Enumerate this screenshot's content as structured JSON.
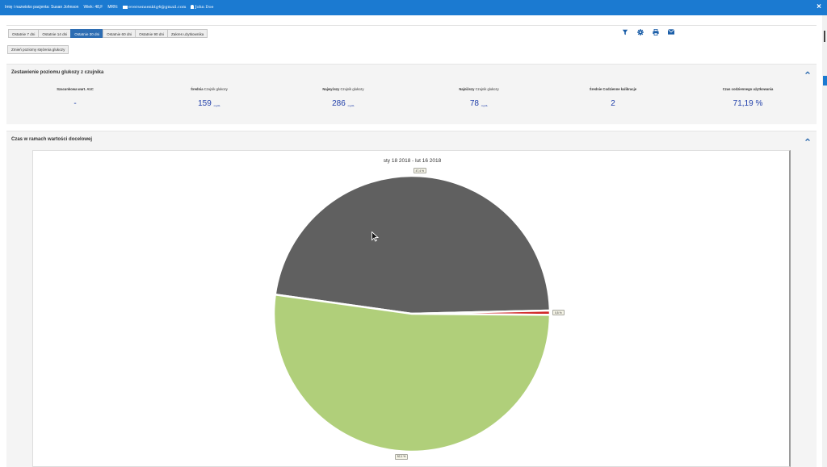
{
  "header": {
    "patient_label": "Imię i nazwisko pacjenta:",
    "patient_name": "Susan Johnson",
    "age_label": "Wiek:",
    "age_value": "48,F",
    "mrn_label": "MRN:",
    "email": "eversensenktg4@gmail.com",
    "user": "John Doe",
    "close_glyph": "×"
  },
  "tabs": [
    {
      "label": "Ostatnie 7 dni",
      "active": false
    },
    {
      "label": "Ostatnie 14 dni",
      "active": false
    },
    {
      "label": "Ostatnie 30 dni",
      "active": true
    },
    {
      "label": "Ostatnie 60 dni",
      "active": false
    },
    {
      "label": "Ostatnie 90 dni",
      "active": false
    },
    {
      "label": "Zakres użytkownika",
      "active": false
    }
  ],
  "toolbar": {
    "icons": [
      "filter-icon",
      "gear-icon",
      "print-icon",
      "envelope-icon"
    ]
  },
  "levels_button": "Zmień poziomy stężenia glukozy",
  "summary_panel": {
    "title": "Zestawienie poziomu glukozy z czujnika",
    "stats": [
      {
        "label_bold": "Szacunkowa wart. A1C",
        "label_rest": "",
        "value": "-",
        "unit": ""
      },
      {
        "label_bold": "Średnia",
        "label_rest": " Czujnik glukozy",
        "value": "159",
        "unit": "mg/dL"
      },
      {
        "label_bold": "Najwyższy",
        "label_rest": " Czujnik glukozy",
        "value": "286",
        "unit": "mg/dL"
      },
      {
        "label_bold": "Najniższy",
        "label_rest": " Czujnik glukozy",
        "value": "78",
        "unit": "mg/dL"
      },
      {
        "label_bold": "Średnie Codzienne kalibracje",
        "label_rest": "",
        "value": "2",
        "unit": ""
      },
      {
        "label_bold": "Czas codziennego użytkowania",
        "label_rest": "",
        "value": "71,19 %",
        "unit": ""
      }
    ]
  },
  "time_in_range_panel": {
    "title": "Czas w ramach wartości docelowej"
  },
  "chart_data": {
    "type": "pie",
    "title": "sty 18 2018 - lut 16 2018",
    "slices": [
      {
        "label": "47,4 %",
        "value": 47.4,
        "color": "#606060"
      },
      {
        "label": "0,5 %",
        "value": 0.5,
        "color": "#d02828"
      },
      {
        "label": "52,1 %",
        "value": 52.1,
        "color": "#b0cf7a"
      }
    ],
    "legend": false
  },
  "colors": {
    "header_bg": "#1b7ad1",
    "active_tab": "#2d6db3",
    "stat_value": "#1f3ea9"
  }
}
